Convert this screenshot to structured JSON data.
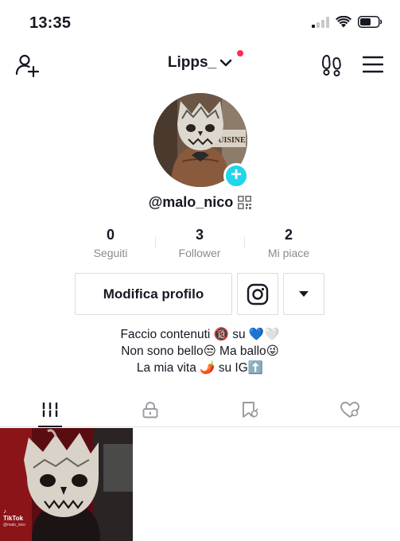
{
  "status_bar": {
    "time": "13:35",
    "icons": [
      "cellular-signal-icon",
      "wifi-icon",
      "battery-icon"
    ]
  },
  "header": {
    "title": "Lipps_",
    "icons": [
      "add-user-icon",
      "chevron-down-icon",
      "footprints-icon",
      "menu-icon"
    ],
    "notification_color": "#fe2c55"
  },
  "profile": {
    "username": "@malo_nico",
    "avatar_badge": "+",
    "avatar_badge_color": "#20d5ec",
    "avatar_shirt_text": "CUISINE"
  },
  "stats": [
    {
      "value": "0",
      "label": "Seguiti"
    },
    {
      "value": "3",
      "label": "Follower"
    },
    {
      "value": "2",
      "label": "Mi piace"
    }
  ],
  "actions": {
    "edit_label": "Modifica profilo",
    "instagram_icon": "instagram-icon",
    "more_icon": "caret-down-icon"
  },
  "bio": {
    "lines": [
      "Faccio contenuti 🔞 su 💙🤍",
      "Non sono bello😒 Ma ballo😜",
      "La mia vita 🌶️ su IG⬆️"
    ]
  },
  "tabs": [
    {
      "icon": "grid-icon",
      "active": true
    },
    {
      "icon": "lock-icon",
      "active": false
    },
    {
      "icon": "bookmark-icon",
      "active": false
    },
    {
      "icon": "liked-heart-icon",
      "active": false
    }
  ],
  "videos": [
    {
      "watermark": "TikTok",
      "watermark_user": "@malo_nico"
    }
  ]
}
